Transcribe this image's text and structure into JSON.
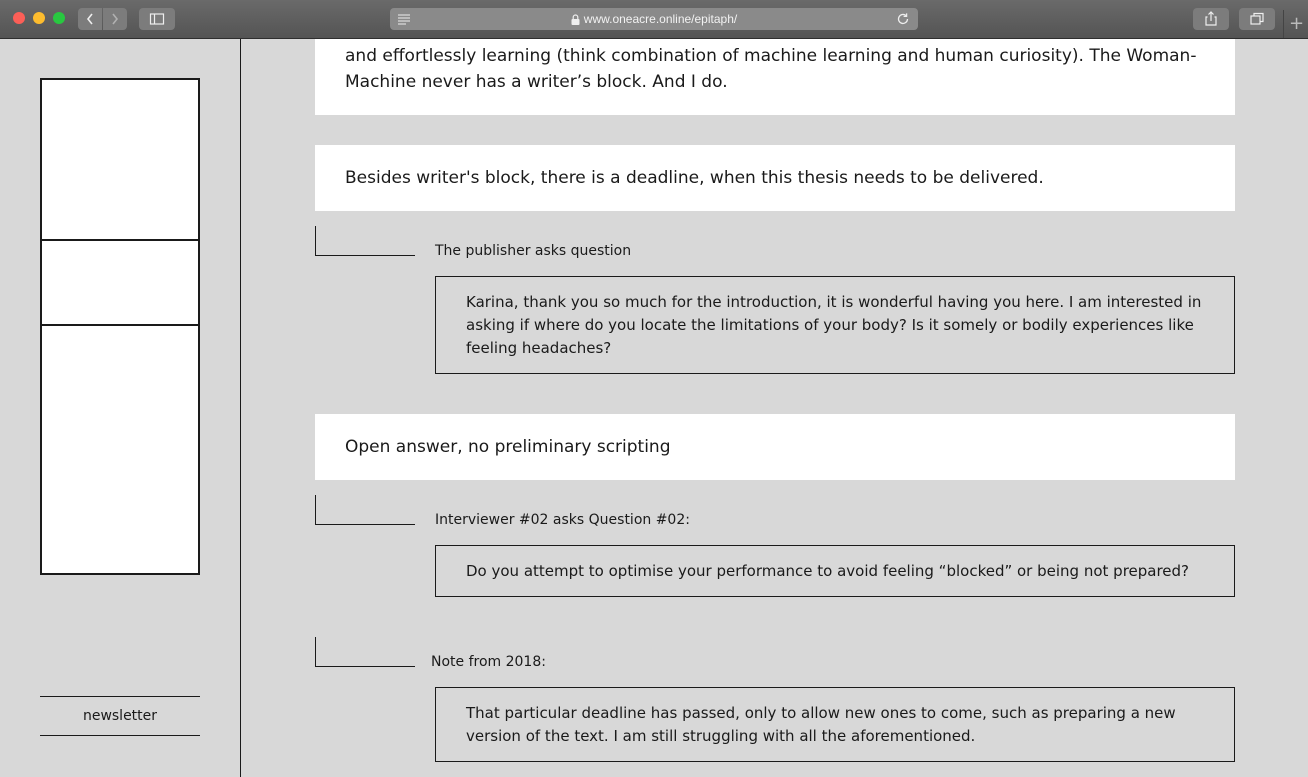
{
  "browser": {
    "url": "www.oneacre.online/epitaph/",
    "new_tab": "+"
  },
  "sidebar": {
    "newsletter": "newsletter"
  },
  "content": {
    "intro_text": "and effortlessly learning (think combination of machine learning and human curiosity). The Woman-Machine never has a writer’s block. And I do.",
    "statement": "Besides writer's block, there is a deadline, when this thesis needs to be delivered.",
    "publisher_label": "The publisher asks question",
    "publisher_question": "Karina, thank you so much for the introduction, it is wonderful having you here. I am interested in asking if where do you locate the limitations of your body? Is it somely or bodily experiences like feeling headaches?",
    "open_answer": "Open answer, no preliminary scripting",
    "interviewer_label": "Interviewer #02 asks Question #02:",
    "interviewer_question": "Do you attempt to optimise your performance to avoid feeling “blocked” or being not prepared?",
    "note_label": "Note from 2018:",
    "note_text": "That particular deadline has passed, only to allow new ones to come, such as preparing a new version of the text. I am still struggling with all the aforementioned."
  },
  "colors": {
    "page_bg": "#d8d8d8",
    "card_bg": "#ffffff",
    "text": "#1a1a1a"
  }
}
